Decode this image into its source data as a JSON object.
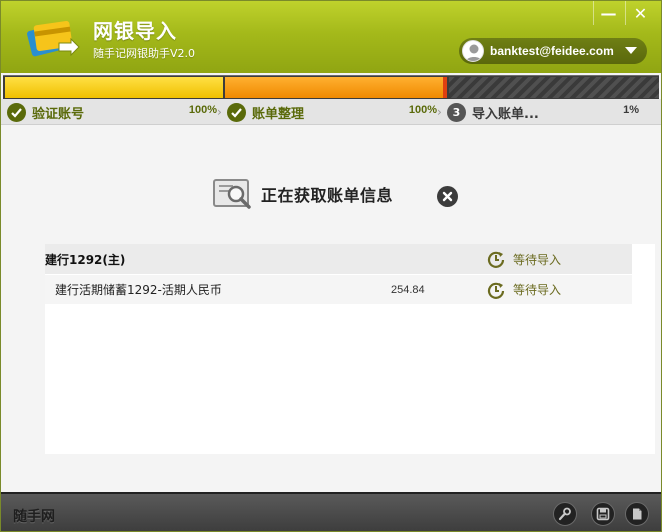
{
  "window": {
    "title": "网银导入",
    "subtitle": "随手记网银助手V2.0",
    "minimize_label": "—",
    "close_label": "✕"
  },
  "user": {
    "email": "banktest@feidee.com",
    "avatar_icon": "user-avatar-icon",
    "dropdown_icon": "caret-down-icon"
  },
  "progress": {
    "steps": [
      {
        "label": "验证账号",
        "percent": "100%",
        "state": "done",
        "fill": 1.0
      },
      {
        "label": "账单整理",
        "percent": "100%",
        "state": "done",
        "fill": 1.0
      },
      {
        "number": "3",
        "label": "导入账单...",
        "percent": "1%",
        "state": "active",
        "fill": 0.01
      }
    ],
    "separator": "›"
  },
  "status": {
    "text": "正在获取账单信息",
    "icon": "search-document-icon",
    "cancel_icon": "close-circle-icon"
  },
  "accounts": [
    {
      "name": "建行1292(主)",
      "amount": "",
      "status": "等待导入",
      "type": "group"
    },
    {
      "name": "建行活期储蓄1292-活期人民币",
      "amount": "254.84",
      "status": "等待导入",
      "type": "item"
    }
  ],
  "footer": {
    "brand": "随手网",
    "buttons": [
      "settings-wrench-icon",
      "save-disk-icon",
      "document-icon"
    ]
  },
  "colors": {
    "title_green": "#a4b91a",
    "step_green": "#5a6a0a",
    "progress_yellow": "#f0c000",
    "progress_orange": "#f08a00",
    "footer_dark": "#3c3c3c"
  }
}
